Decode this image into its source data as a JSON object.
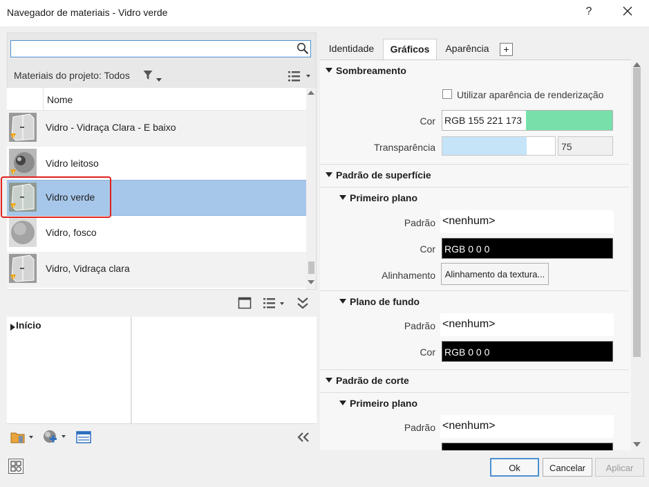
{
  "window": {
    "title": "Navegador de materiais - Vidro verde",
    "help_glyph": "?"
  },
  "library": {
    "search_value": "",
    "filter_label": "Materiais do projeto: Todos",
    "column_header": "Nome",
    "materials": [
      {
        "name": "Vidro - Vidraça Clara - E baixo",
        "thumb": "glass-pane-icon",
        "warning": true,
        "selected": false
      },
      {
        "name": "Vidro leitoso",
        "thumb": "glass-sphere-icon",
        "warning": true,
        "selected": false
      },
      {
        "name": "Vidro verde",
        "thumb": "glass-pane-icon",
        "warning": true,
        "selected": true
      },
      {
        "name": "Vidro, fosco",
        "thumb": "frosted-sphere-icon",
        "warning": false,
        "selected": false
      },
      {
        "name": "Vidro, Vidraça clara",
        "thumb": "glass-pane-icon",
        "warning": true,
        "selected": false
      }
    ],
    "tree_root": "Início"
  },
  "tabs": [
    {
      "label": "Identidade",
      "active": false
    },
    {
      "label": "Gráficos",
      "active": true
    },
    {
      "label": "Aparência",
      "active": false
    }
  ],
  "tab_add_label": "+",
  "graphics": {
    "shading": {
      "title": "Sombreamento",
      "render_appearance_label": "Utilizar aparência de renderização",
      "render_appearance_checked": false,
      "color_label": "Cor",
      "color_value": "RGB 155 221 173",
      "color_hex": "#9bddad",
      "transparency_label": "Transparência",
      "transparency_value": "75",
      "transparency_level": 0.75
    },
    "surface_pattern": {
      "title": "Padrão de superfície",
      "foreground": {
        "title": "Primeiro plano",
        "pattern_label": "Padrão",
        "pattern_value": "<nenhum>",
        "color_label": "Cor",
        "color_value": "RGB 0 0 0",
        "alignment_label": "Alinhamento",
        "alignment_button": "Alinhamento da textura..."
      },
      "background": {
        "title": "Plano de fundo",
        "pattern_label": "Padrão",
        "pattern_value": "<nenhum>",
        "color_label": "Cor",
        "color_value": "RGB 0 0 0"
      }
    },
    "cut_pattern": {
      "title": "Padrão de corte",
      "foreground": {
        "title": "Primeiro plano",
        "pattern_label": "Padrão",
        "pattern_value": "<nenhum>",
        "color_value": "RGB 0 0 0"
      }
    }
  },
  "footer": {
    "ok": "Ok",
    "cancel": "Cancelar",
    "apply": "Aplicar"
  }
}
